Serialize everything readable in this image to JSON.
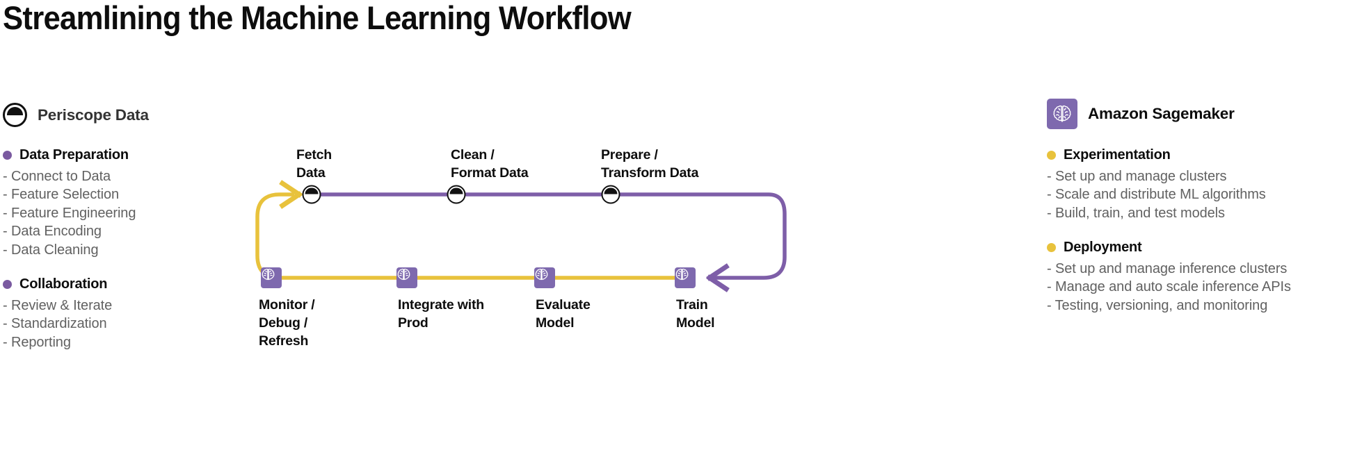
{
  "title": "Streamlining the Machine Learning Workflow",
  "colors": {
    "purple_line": "#7e5ea8",
    "yellow_line": "#e8c23c",
    "purple_bullet": "#7a5aa0",
    "yellow_bullet": "#e8c23c",
    "sagemaker_tile": "#7e69ae",
    "body_text": "#616161",
    "heading_text": "#0d0d0d"
  },
  "left_panel": {
    "brand": "Periscope Data",
    "logo_icon": "periscope-logo-icon",
    "groups": [
      {
        "title": "Data Preparation",
        "bullet_color": "purple",
        "items": [
          "- Connect to Data",
          "- Feature Selection",
          "- Feature Engineering",
          "- Data Encoding",
          "- Data Cleaning"
        ]
      },
      {
        "title": "Collaboration",
        "bullet_color": "purple",
        "items": [
          "- Review & Iterate",
          "- Standardization",
          "- Reporting"
        ]
      }
    ]
  },
  "right_panel": {
    "brand": "Amazon Sagemaker",
    "logo_icon": "brain-icon",
    "groups": [
      {
        "title": "Experimentation",
        "bullet_color": "yellow",
        "items": [
          "- Set up and manage clusters",
          "- Scale and distribute ML algorithms",
          "- Build, train, and test models"
        ]
      },
      {
        "title": "Deployment",
        "bullet_color": "yellow",
        "items": [
          "- Set up and manage inference clusters",
          "- Manage and auto scale inference APIs",
          "- Testing, versioning, and monitoring"
        ]
      }
    ]
  },
  "diagram": {
    "top_row": {
      "line_color": "#7e5ea8",
      "node_icon": "periscope-logo-icon",
      "nodes": [
        {
          "label": "Fetch\nData"
        },
        {
          "label": "Clean /\nFormat Data"
        },
        {
          "label": "Prepare /\nTransform Data"
        }
      ]
    },
    "bottom_row": {
      "line_color": "#e8c23c",
      "node_icon": "brain-icon",
      "nodes": [
        {
          "label": "Monitor /\nDebug /\nRefresh"
        },
        {
          "label": "Integrate with\nProd"
        },
        {
          "label": "Evaluate\nModel"
        },
        {
          "label": "Train\nModel"
        }
      ]
    },
    "connectors": [
      {
        "name": "purple-return-curve",
        "from": "Prepare / Transform Data",
        "to": "Train Model",
        "arrow": "left"
      },
      {
        "name": "yellow-return-curve",
        "from": "Monitor / Debug / Refresh",
        "to": "Fetch Data",
        "arrow": "right"
      }
    ]
  }
}
